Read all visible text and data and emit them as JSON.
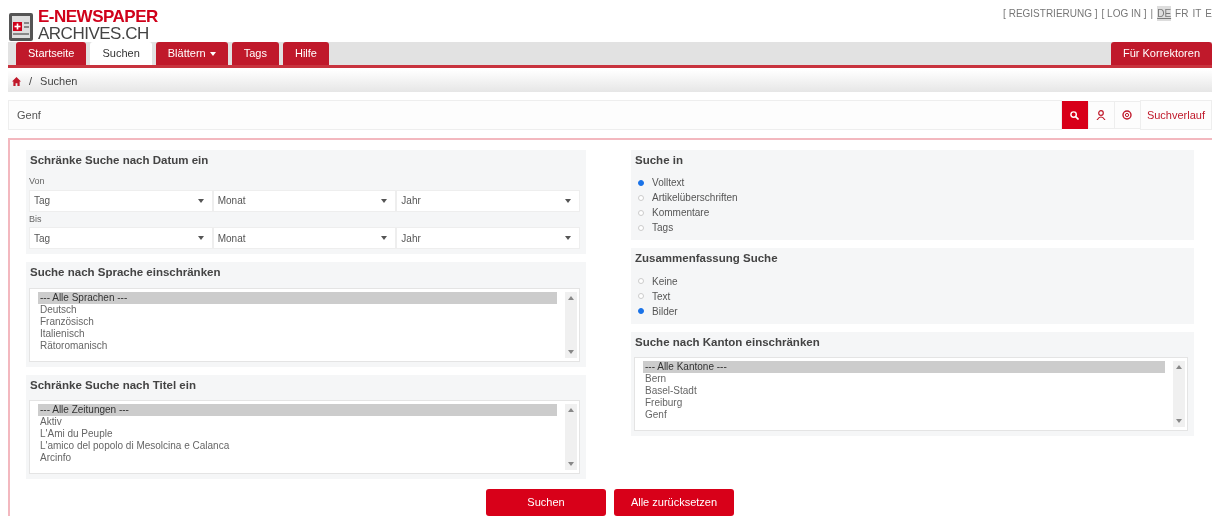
{
  "logo": {
    "line_1": "E-NEWSPAPER",
    "line_2": "ARCHIVES.CH"
  },
  "top_links": [
    {
      "label": "[ REGISTRIERUNG ]",
      "kind": "link"
    },
    {
      "label": "[ LOG IN ]",
      "kind": "link"
    },
    {
      "label": "|",
      "kind": "separator"
    },
    {
      "label": "DE",
      "kind": "language",
      "selected": true
    },
    {
      "label": "FR",
      "kind": "language",
      "selected": false
    },
    {
      "label": "IT",
      "kind": "language",
      "selected": false
    },
    {
      "label": "E",
      "kind": "language",
      "selected": false
    }
  ],
  "tabs": [
    {
      "label": "Startseite",
      "selected": false,
      "dropdown": false
    },
    {
      "label": "Suchen",
      "selected": true,
      "dropdown": false
    },
    {
      "label": "Blättern",
      "selected": false,
      "dropdown": true
    },
    {
      "label": "Tags",
      "selected": false,
      "dropdown": false
    },
    {
      "label": "Hilfe",
      "selected": false,
      "dropdown": false
    }
  ],
  "right_tab": {
    "label": "Für Korrektoren"
  },
  "breadcrumb": {
    "separator": "/",
    "current": "Suchen"
  },
  "search": {
    "value": "Genf",
    "history_label": "Suchverlauf"
  },
  "date_filter": {
    "title": "Schränke Suche nach Datum ein",
    "rows": [
      {
        "label": "Von",
        "selects": [
          "Tag",
          "Monat",
          "Jahr"
        ]
      },
      {
        "label": "Bis",
        "selects": [
          "Tag",
          "Monat",
          "Jahr"
        ]
      }
    ]
  },
  "language_filter": {
    "title": "Suche nach Sprache einschränken",
    "items": [
      {
        "label": "--- Alle Sprachen ---",
        "selected": true
      },
      {
        "label": "Deutsch",
        "selected": false
      },
      {
        "label": "Französisch",
        "selected": false
      },
      {
        "label": "Italienisch",
        "selected": false
      },
      {
        "label": "Rätoromanisch",
        "selected": false
      }
    ]
  },
  "title_filter": {
    "title": "Schränke Suche nach Titel ein",
    "items": [
      {
        "label": "--- Alle Zeitungen ---",
        "selected": true
      },
      {
        "label": "Aktiv",
        "selected": false
      },
      {
        "label": "L'Ami du Peuple",
        "selected": false
      },
      {
        "label": "L'amico del popolo di Mesolcina e Calanca",
        "selected": false
      },
      {
        "label": "Arcinfo",
        "selected": false
      }
    ]
  },
  "search_in": {
    "title": "Suche in",
    "options": [
      {
        "label": "Volltext",
        "checked": true
      },
      {
        "label": "Artikelüberschriften",
        "checked": false
      },
      {
        "label": "Kommentare",
        "checked": false
      },
      {
        "label": "Tags",
        "checked": false
      }
    ]
  },
  "summary": {
    "title": "Zusammenfassung Suche",
    "options": [
      {
        "label": "Keine",
        "checked": false
      },
      {
        "label": "Text",
        "checked": false
      },
      {
        "label": "Bilder",
        "checked": true
      }
    ]
  },
  "canton_filter": {
    "title": "Suche nach Kanton einschränken",
    "items": [
      {
        "label": "--- Alle Kantone ---",
        "selected": true
      },
      {
        "label": "Bern",
        "selected": false
      },
      {
        "label": "Basel-Stadt",
        "selected": false
      },
      {
        "label": "Freiburg",
        "selected": false
      },
      {
        "label": "Genf",
        "selected": false
      }
    ]
  },
  "buttons": [
    {
      "label": "Suchen"
    },
    {
      "label": "Alle zurücksetzen"
    }
  ]
}
